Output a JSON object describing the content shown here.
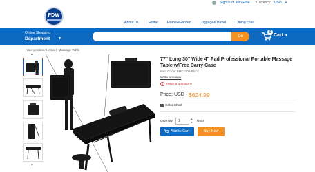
{
  "topbar": {
    "signin": "Sign In or Join Free",
    "currency_label": "Currency:",
    "currency_value": "USD",
    "icons": [
      "user-icon",
      "chevron-down-icon"
    ]
  },
  "logo": {
    "text": "FDW"
  },
  "nav": [
    "About us",
    "Home",
    "Home&Garden",
    "Luggage&Travel",
    "Dining chair"
  ],
  "header": {
    "shop_label": "Online Shopping",
    "department": "Department",
    "search_placeholder": "",
    "go_label": "Go",
    "cart_count": "0",
    "cart_label": "Cart",
    "colors": {
      "bar": "#0e6ac0",
      "go": "#f39221"
    }
  },
  "breadcrumb": {
    "prefix": "Your position:",
    "home": "Home",
    "separator": ">",
    "current": "Massage Table"
  },
  "product": {
    "title": "77\" Long 30\" Wide 4\" Pad Professional Portable Massage Table w/Free Carry Case",
    "item_code": "Item Code: BMC-300-Black",
    "write_review": "Write a review",
    "question": "Have a question?",
    "price_label": "Price:",
    "price_currency": "USD -",
    "price_value": "$624.99",
    "color_chart": "Color Chart",
    "quantity_label": "Quantity:",
    "quantity_value": "1",
    "units": "Units",
    "add_to_cart": "Add to Cart",
    "buy_now": "Buy Now",
    "price_color": "#f39221"
  },
  "thumbnails": {
    "count": 5,
    "active_index": 0
  }
}
